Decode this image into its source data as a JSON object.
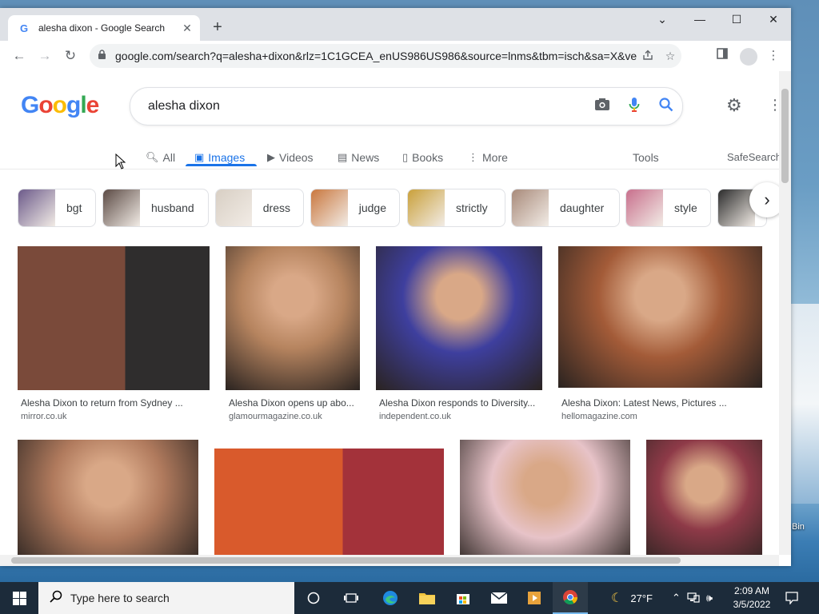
{
  "browser": {
    "tab_title": "alesha dixon - Google Search",
    "tab_favicon": "G",
    "url": "google.com/search?q=alesha+dixon&rlz=1C1GCEA_enUS986US986&source=lnms&tbm=isch&sa=X&ved...",
    "window_controls": {
      "tab_search": "⌄",
      "minimize": "—",
      "maximize": "☐",
      "close": "✕"
    }
  },
  "search": {
    "query": "alesha dixon",
    "logo_letters": [
      "G",
      "o",
      "o",
      "g",
      "l",
      "e"
    ]
  },
  "tabs": [
    {
      "label": "All",
      "icon": "search-icon"
    },
    {
      "label": "Images",
      "icon": "image-icon",
      "active": true
    },
    {
      "label": "Videos",
      "icon": "play-icon"
    },
    {
      "label": "News",
      "icon": "news-icon"
    },
    {
      "label": "Books",
      "icon": "book-icon"
    },
    {
      "label": "More",
      "icon": "more-vertical-icon"
    }
  ],
  "tools_label": "Tools",
  "safesearch_label": "SafeSearch",
  "chips": [
    {
      "label": "bgt",
      "color": "#6c5a8a"
    },
    {
      "label": "husband",
      "color": "#5b4a44"
    },
    {
      "label": "dress",
      "color": "#d8cfc4"
    },
    {
      "label": "judge",
      "color": "#c9773e"
    },
    {
      "label": "strictly",
      "color": "#c9a03a"
    },
    {
      "label": "daughter",
      "color": "#a88a7a"
    },
    {
      "label": "style",
      "color": "#c86f8c"
    },
    {
      "label": "",
      "color": "#2b2b2b"
    }
  ],
  "results": [
    {
      "title": "Alesha Dixon to return from Sydney ...",
      "source": "mirror.co.uk",
      "colors": [
        "#7a4a3a",
        "#2f2d2d"
      ]
    },
    {
      "title": "Alesha Dixon opens up abo...",
      "source": "glamourmagazine.co.uk",
      "colors": [
        "#b6845f"
      ]
    },
    {
      "title": "Alesha Dixon responds to Diversity...",
      "source": "independent.co.uk",
      "colors": [
        "#3e3f9e"
      ]
    },
    {
      "title": "Alesha Dixon: Latest News, Pictures ...",
      "source": "hellomagazine.com",
      "colors": [
        "#a35b38"
      ]
    },
    {
      "title": "",
      "source": "",
      "colors": [
        "#b07a5d"
      ]
    },
    {
      "title": "",
      "source": "",
      "colors": [
        "#d95a2c",
        "#a3323a"
      ]
    },
    {
      "title": "",
      "source": "",
      "colors": [
        "#e7c3c8"
      ]
    },
    {
      "title": "",
      "source": "",
      "colors": [
        "#8e3a48"
      ]
    }
  ],
  "desktop": {
    "label_right": "Bin"
  },
  "taskbar": {
    "search_placeholder": "Type here to search",
    "weather": "27°F",
    "time": "2:09 AM",
    "date": "3/5/2022"
  }
}
